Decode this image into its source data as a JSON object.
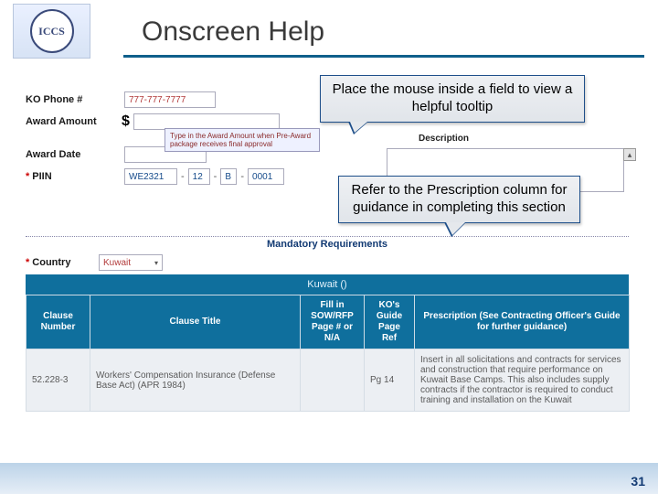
{
  "logo_text": "ICCS",
  "title": "Onscreen Help",
  "callouts": {
    "co1": "Place the mouse inside a field to view a helpful tooltip",
    "co2": "Refer to the Prescription column for guidance in completing this section"
  },
  "form": {
    "ko_phone_label": "KO Phone #",
    "ko_phone_value": "777-777-7777",
    "award_amount_label": "Award Amount",
    "dollar": "$",
    "tooltip_text": "Type in the Award Amount when Pre-Award package receives final approval",
    "award_date_label": "Award Date",
    "piin_label": "PIIN",
    "piin": {
      "a": "WE2321",
      "b": "12",
      "c": "B",
      "d": "0001"
    },
    "description_label": "Description",
    "mandatory_heading": "Mandatory Requirements",
    "country_label": "Country",
    "country_value": "Kuwait",
    "kuwait_strip": "Kuwait ()"
  },
  "table": {
    "headers": {
      "clause_number": "Clause Number",
      "clause_title": "Clause Title",
      "fill": "Fill in SOW/RFP Page # or N/A",
      "guide": "KO's Guide Page Ref",
      "prescription": "Prescription (See Contracting Officer's Guide for further guidance)"
    },
    "rows": [
      {
        "num": "52.228-3",
        "title": "Workers' Compensation Insurance (Defense Base Act) (APR 1984)",
        "fill": "",
        "guide": "Pg 14",
        "presc": "Insert in all solicitations and contracts for services and construction that require performance on Kuwait Base Camps. This also includes supply contracts if the contractor is required to conduct training and installation on the Kuwait"
      }
    ]
  },
  "page_number": "31"
}
